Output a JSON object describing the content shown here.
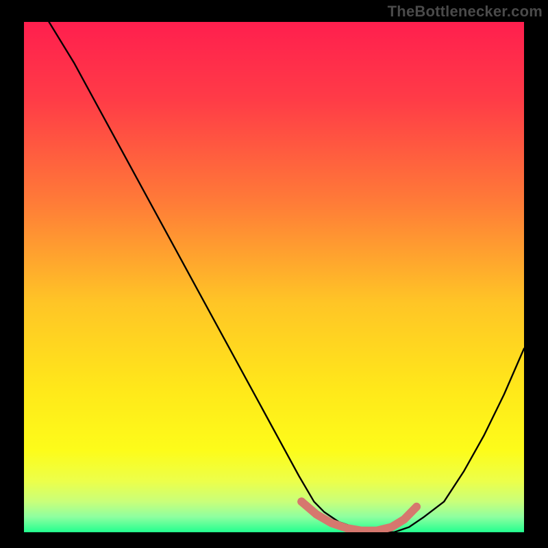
{
  "attribution": "TheBottlenecker.com",
  "palette": {
    "bg": "#000000",
    "attribution_text": "#4a4a4a",
    "curve": "#000000",
    "marker": "#d6776e",
    "gradient_stops": [
      {
        "offset": 0.0,
        "color": "#ff1f4e"
      },
      {
        "offset": 0.15,
        "color": "#ff3b47"
      },
      {
        "offset": 0.35,
        "color": "#ff7a38"
      },
      {
        "offset": 0.55,
        "color": "#ffc526"
      },
      {
        "offset": 0.72,
        "color": "#ffe81a"
      },
      {
        "offset": 0.84,
        "color": "#fdfc1a"
      },
      {
        "offset": 0.9,
        "color": "#ecff4a"
      },
      {
        "offset": 0.94,
        "color": "#c9ff7a"
      },
      {
        "offset": 0.97,
        "color": "#8effa0"
      },
      {
        "offset": 1.0,
        "color": "#23ff8f"
      }
    ]
  },
  "chart_data": {
    "type": "line",
    "title": "",
    "xlabel": "",
    "ylabel": "",
    "xlim": [
      0,
      1
    ],
    "ylim": [
      0,
      1
    ],
    "grid": false,
    "legend": false,
    "series": [
      {
        "name": "bottleneck-curve",
        "x": [
          0.0,
          0.05,
          0.1,
          0.15,
          0.2,
          0.25,
          0.3,
          0.35,
          0.4,
          0.45,
          0.5,
          0.55,
          0.58,
          0.6,
          0.63,
          0.66,
          0.7,
          0.74,
          0.77,
          0.8,
          0.84,
          0.88,
          0.92,
          0.96,
          1.0
        ],
        "y": [
          1.08,
          1.0,
          0.92,
          0.83,
          0.74,
          0.65,
          0.56,
          0.47,
          0.38,
          0.29,
          0.2,
          0.11,
          0.06,
          0.04,
          0.02,
          0.01,
          0.0,
          0.0,
          0.01,
          0.03,
          0.06,
          0.12,
          0.19,
          0.27,
          0.36
        ]
      }
    ],
    "highlight_region": {
      "x": [
        0.555,
        0.585,
        0.615,
        0.645,
        0.675,
        0.705,
        0.735,
        0.76,
        0.785
      ],
      "y": [
        0.06,
        0.035,
        0.018,
        0.008,
        0.003,
        0.003,
        0.01,
        0.025,
        0.05
      ]
    },
    "annotations": []
  }
}
